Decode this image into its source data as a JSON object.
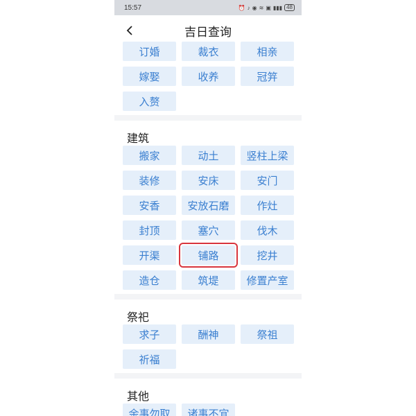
{
  "status_bar": {
    "time": "15:57",
    "signal_icons": [
      "alarm-icon",
      "mute-icon",
      "location-icon",
      "wifi-icon",
      "nfc-icon",
      "signal-icon"
    ],
    "battery": "48"
  },
  "header": {
    "title": "吉日查询",
    "back_icon": "chevron-left-icon"
  },
  "sections": [
    {
      "title": "",
      "items": [
        "订婚",
        "裁衣",
        "相亲",
        "嫁娶",
        "收养",
        "冠笄",
        "入赘"
      ]
    },
    {
      "title": "建筑",
      "items": [
        "搬家",
        "动土",
        "竖柱上梁",
        "装修",
        "安床",
        "安门",
        "安香",
        "安放石磨",
        "作灶",
        "封顶",
        "塞穴",
        "伐木",
        "开渠",
        "铺路",
        "挖井",
        "造仓",
        "筑堤",
        "修置产室"
      ]
    },
    {
      "title": "祭祀",
      "items": [
        "求子",
        "酬神",
        "祭祖",
        "祈福"
      ]
    },
    {
      "title": "其他",
      "items": [
        "余事勿取",
        "诸事不宜"
      ]
    }
  ],
  "highlighted_item": "铺路",
  "colors": {
    "chip_bg": "#e5effa",
    "chip_text": "#3a7fd0",
    "highlight": "#d8343c"
  }
}
